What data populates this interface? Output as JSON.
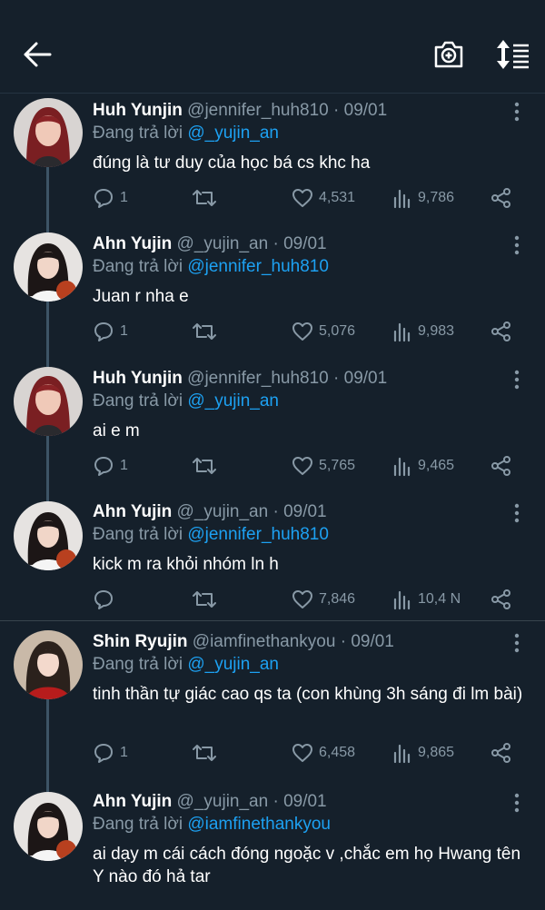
{
  "topbar": {
    "back_icon": "arrow-left-icon",
    "camera_icon": "camera-plus-icon",
    "sort_icon": "sort-icon"
  },
  "colors": {
    "background": "#15202b",
    "secondary_text": "#8899a6",
    "mention": "#1da1f2",
    "thread_line": "#3d5466"
  },
  "tweets": [
    {
      "name": "Huh Yunjin",
      "handle": "@jennifer_huh810",
      "date": "09/01",
      "replying_prefix": "Đang trả lời",
      "replying_to": "@_yujin_an",
      "text": "đúng là tư duy của học bá cs khc ha",
      "replies": "1",
      "retweets": "",
      "likes": "4,531",
      "views": "9,786"
    },
    {
      "name": "Ahn Yujin",
      "handle": "@_yujin_an",
      "date": "09/01",
      "replying_prefix": "Đang trả lời",
      "replying_to": "@jennifer_huh810",
      "text": "Juan r nha e",
      "replies": "1",
      "retweets": "",
      "likes": "5,076",
      "views": "9,983"
    },
    {
      "name": "Huh Yunjin",
      "handle": "@jennifer_huh810",
      "date": "09/01",
      "replying_prefix": "Đang trả lời",
      "replying_to": "@_yujin_an",
      "text": "ai e m",
      "replies": "1",
      "retweets": "",
      "likes": "5,765",
      "views": "9,465"
    },
    {
      "name": "Ahn Yujin",
      "handle": "@_yujin_an",
      "date": "09/01",
      "replying_prefix": "Đang trả lời",
      "replying_to": "@jennifer_huh810",
      "text": "kick m ra khỏi nhóm ln h",
      "replies": "",
      "retweets": "",
      "likes": "7,846",
      "views": "10,4 N"
    },
    {
      "name": "Shin Ryujin",
      "handle": "@iamfinethankyou",
      "date": "09/01",
      "replying_prefix": "Đang trả lời",
      "replying_to": "@_yujin_an",
      "text": "tinh thần tự giác cao qs ta (con khùng 3h sáng đi lm bài)",
      "replies": "1",
      "retweets": "",
      "likes": "6,458",
      "views": "9,865"
    },
    {
      "name": "Ahn Yujin",
      "handle": "@_yujin_an",
      "date": "09/01",
      "replying_prefix": "Đang trả lời",
      "replying_to": "@iamfinethankyou",
      "text": "ai dạy m cái cách đóng ngoặc v ,chắc em họ Hwang tên Y nào đó hả tar",
      "replies": "",
      "retweets": "",
      "likes": "",
      "views": ""
    }
  ]
}
